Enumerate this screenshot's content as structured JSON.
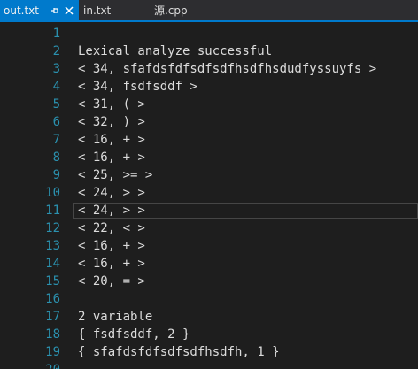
{
  "tabs": [
    {
      "label": "out.txt",
      "active": true
    },
    {
      "label": "in.txt",
      "active": false
    },
    {
      "label": "源.cpp",
      "active": false
    }
  ],
  "icons": {
    "pin": "pin-icon",
    "close": "close-icon"
  },
  "colors": {
    "accent": "#007acc",
    "editor_bg": "#1e1e1e",
    "line_number": "#2b91af",
    "text": "#dcdcdc"
  },
  "editor": {
    "current_line": 11,
    "lines": [
      {
        "num": "1",
        "text": ""
      },
      {
        "num": "2",
        "text": "Lexical analyze successful"
      },
      {
        "num": "3",
        "text": "< 34, sfafdsfdfsdfsdfhsdfhsdudfyssuyfs >"
      },
      {
        "num": "4",
        "text": "< 34, fsdfsddf >"
      },
      {
        "num": "5",
        "text": "< 31, ( >"
      },
      {
        "num": "6",
        "text": "< 32, ) >"
      },
      {
        "num": "7",
        "text": "< 16, + >"
      },
      {
        "num": "8",
        "text": "< 16, + >"
      },
      {
        "num": "9",
        "text": "< 25, >= >"
      },
      {
        "num": "10",
        "text": "< 24, > >"
      },
      {
        "num": "11",
        "text": "< 24, > >"
      },
      {
        "num": "12",
        "text": "< 22, < >"
      },
      {
        "num": "13",
        "text": "< 16, + >"
      },
      {
        "num": "14",
        "text": "< 16, + >"
      },
      {
        "num": "15",
        "text": "< 20, = >"
      },
      {
        "num": "16",
        "text": ""
      },
      {
        "num": "17",
        "text": "2 variable"
      },
      {
        "num": "18",
        "text": "{ fsdfsddf, 2 }"
      },
      {
        "num": "19",
        "text": "{ sfafdsfdfsdfsdfhsdfh, 1 }"
      },
      {
        "num": "20",
        "text": ""
      }
    ]
  }
}
